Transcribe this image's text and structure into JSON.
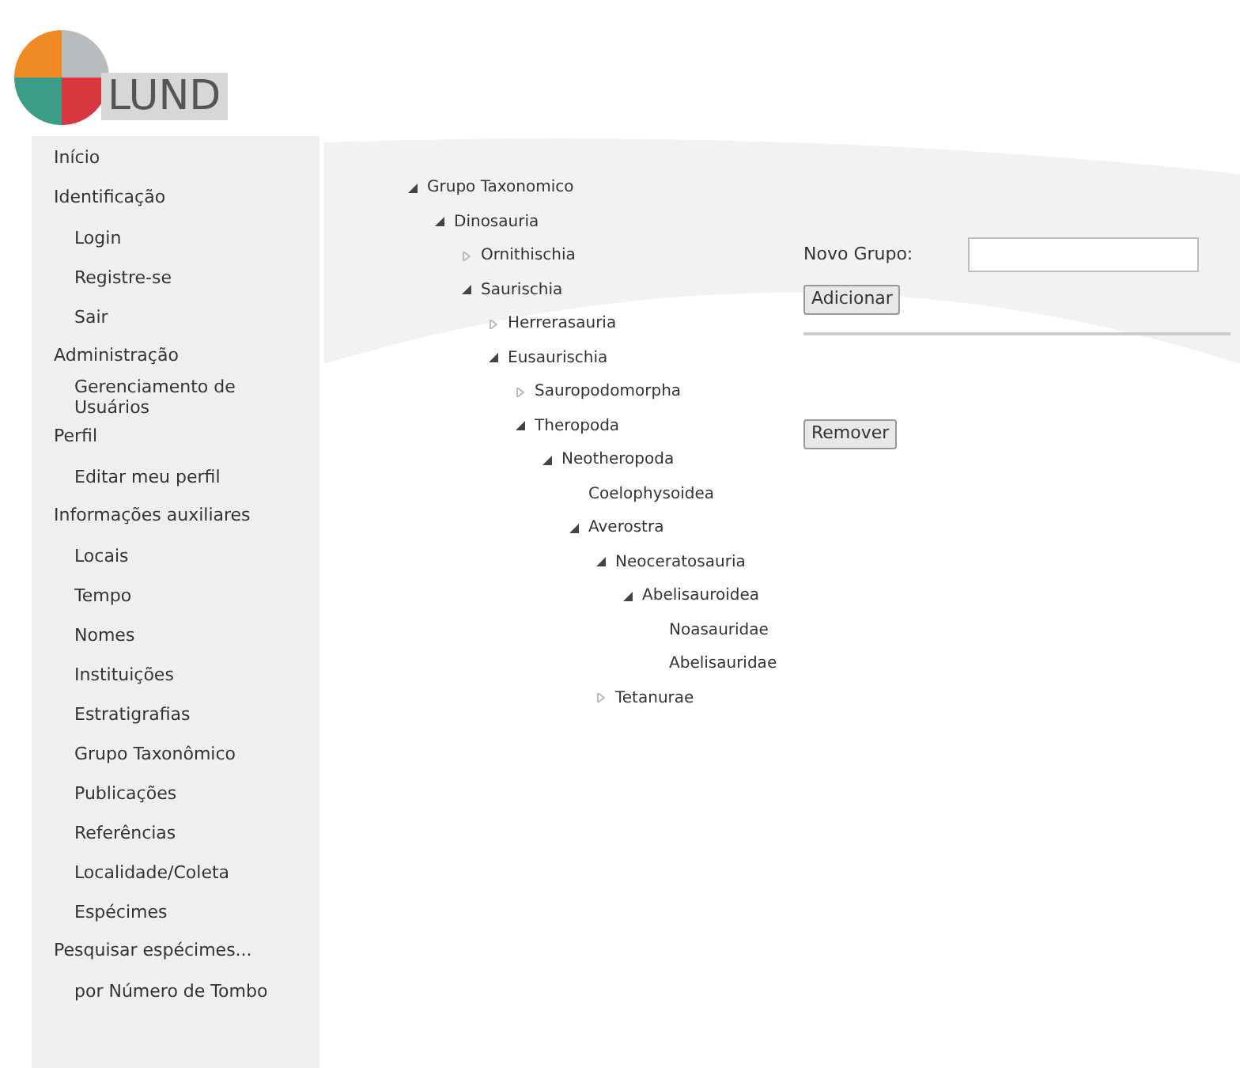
{
  "logo": {
    "text": "LUND"
  },
  "sidebar": {
    "items": [
      {
        "label": "Início"
      },
      {
        "label": "Identificação",
        "children": [
          {
            "label": "Login"
          },
          {
            "label": "Registre-se"
          },
          {
            "label": "Sair"
          }
        ]
      },
      {
        "label": "Administração",
        "children": [
          {
            "label": "Gerenciamento de Usuários"
          }
        ]
      },
      {
        "label": "Perfil",
        "children": [
          {
            "label": "Editar meu perfil"
          }
        ]
      },
      {
        "label": "Informações auxiliares",
        "children": [
          {
            "label": "Locais"
          },
          {
            "label": "Tempo"
          },
          {
            "label": "Nomes"
          },
          {
            "label": "Instituições"
          },
          {
            "label": "Estratigrafias"
          },
          {
            "label": "Grupo Taxonômico"
          },
          {
            "label": "Publicações"
          },
          {
            "label": "Referências"
          },
          {
            "label": "Localidade/Coleta"
          },
          {
            "label": "Espécimes"
          }
        ]
      },
      {
        "label": "Pesquisar espécimes...",
        "children": [
          {
            "label": "por Número de Tombo"
          }
        ]
      }
    ]
  },
  "tree": [
    {
      "label": "Grupo Taxonomico",
      "expanded": true,
      "children": [
        {
          "label": "Dinosauria",
          "expanded": true,
          "children": [
            {
              "label": "Ornithischia",
              "expanded": false
            },
            {
              "label": "Saurischia",
              "expanded": true,
              "children": [
                {
                  "label": "Herrerasauria",
                  "expanded": false
                },
                {
                  "label": "Eusaurischia",
                  "expanded": true,
                  "children": [
                    {
                      "label": "Sauropodomorpha",
                      "expanded": false
                    },
                    {
                      "label": "Theropoda",
                      "expanded": true,
                      "children": [
                        {
                          "label": "Neotheropoda",
                          "expanded": true,
                          "children": [
                            {
                              "label": "Coelophysoidea"
                            },
                            {
                              "label": "Averostra",
                              "expanded": true,
                              "children": [
                                {
                                  "label": "Neoceratosauria",
                                  "expanded": true,
                                  "children": [
                                    {
                                      "label": "Abelisauroidea",
                                      "expanded": true,
                                      "children": [
                                        {
                                          "label": "Noasauridae"
                                        },
                                        {
                                          "label": "Abelisauridae"
                                        }
                                      ]
                                    }
                                  ]
                                },
                                {
                                  "label": "Tetanurae",
                                  "expanded": false
                                }
                              ]
                            }
                          ]
                        }
                      ]
                    }
                  ]
                }
              ]
            }
          ]
        }
      ]
    }
  ],
  "form": {
    "label": "Novo Grupo:",
    "add_button": "Adicionar",
    "remove_button": "Remover"
  }
}
